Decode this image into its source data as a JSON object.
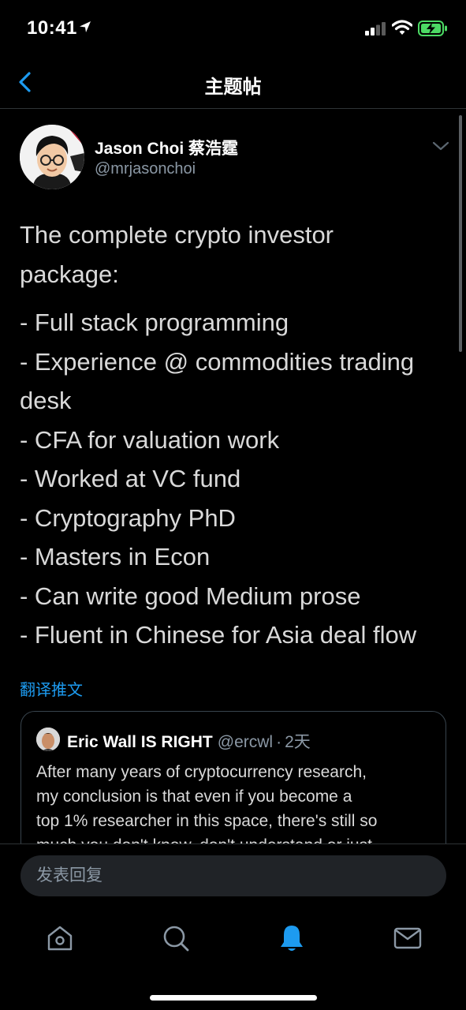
{
  "status_bar": {
    "time": "10:41",
    "icons": [
      "location-arrow-icon",
      "signal-icon",
      "wifi-icon",
      "battery-charging-icon"
    ]
  },
  "nav": {
    "title": "主题帖",
    "back_icon": "chevron-left-icon"
  },
  "tweet": {
    "author_name": "Jason Choi 蔡浩霆",
    "author_handle": "@mrjasonchoi",
    "body_intro": [
      "The complete crypto investor",
      "package:"
    ],
    "body_lines": [
      "- Full stack programming",
      "- Experience @ commodities trading",
      "desk",
      "- CFA for valuation work",
      "- Worked at VC fund",
      "- Cryptography PhD",
      "- Masters in Econ",
      "- Can write good Medium prose",
      "- Fluent in Chinese for Asia deal flow"
    ],
    "translate_label": "翻译推文"
  },
  "quoted_tweet": {
    "author_name": "Eric Wall IS RIGHT",
    "author_handle": "@ercwl",
    "separator": "·",
    "time": "2天",
    "body_lines": [
      "After many years of cryptocurrency research,",
      "my conclusion is that even if you become a",
      "top 1% researcher in this space, there's still so",
      "much you don't know, don't understand or just"
    ]
  },
  "reply": {
    "placeholder": "发表回复"
  },
  "tab_bar": {
    "tabs": [
      {
        "name": "home",
        "icon": "home-icon",
        "active": false
      },
      {
        "name": "search",
        "icon": "search-icon",
        "active": false
      },
      {
        "name": "notifications",
        "icon": "bell-icon",
        "active": true
      },
      {
        "name": "messages",
        "icon": "envelope-icon",
        "active": false
      }
    ]
  },
  "colors": {
    "background": "#000000",
    "accent": "#1d9bf0",
    "text": "#d9d9d9",
    "secondary_text": "#8b98a5",
    "battery": "#4cd964"
  }
}
